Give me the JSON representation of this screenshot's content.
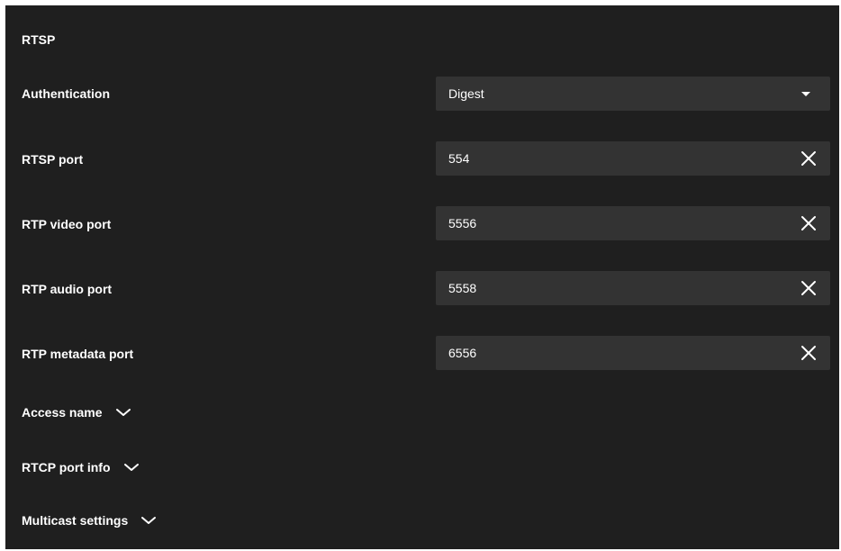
{
  "section": {
    "title": "RTSP"
  },
  "authentication": {
    "label": "Authentication",
    "value": "Digest",
    "icon": "caret-down-icon"
  },
  "rtsp_port": {
    "label": "RTSP port",
    "value": "554"
  },
  "rtp_video_port": {
    "label": "RTP video port",
    "value": "5556"
  },
  "rtp_audio_port": {
    "label": "RTP audio port",
    "value": "5558"
  },
  "rtp_metadata_port": {
    "label": "RTP metadata port",
    "value": "6556"
  },
  "expanders": {
    "access_name": {
      "label": "Access name",
      "icon": "chevron-down-icon"
    },
    "rtcp_port_info": {
      "label": "RTCP port info",
      "icon": "chevron-down-icon"
    },
    "multicast_settings": {
      "label": "Multicast settings",
      "icon": "chevron-down-icon"
    }
  },
  "colors": {
    "panel_background": "#1f1f1f",
    "field_background": "#333333",
    "text": "#ffffff"
  }
}
